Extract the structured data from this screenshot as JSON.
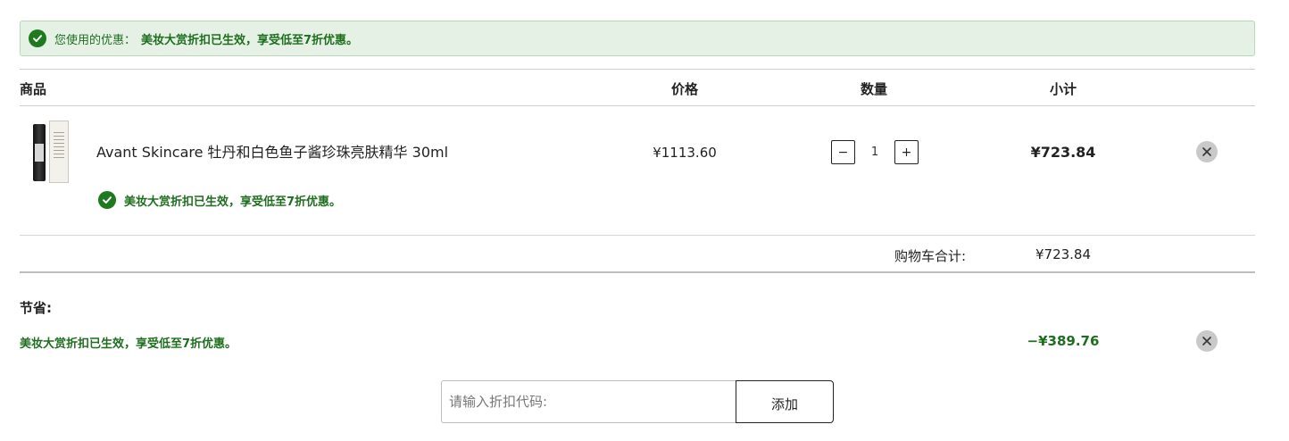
{
  "banner": {
    "label": "您使用的优惠：",
    "message": "美妆大赏折扣已生效，享受低至7折优惠。"
  },
  "table": {
    "headers": {
      "product": "商品",
      "price": "价格",
      "quantity": "数量",
      "subtotal": "小计"
    }
  },
  "item": {
    "name": "Avant Skincare 牡丹和白色鱼子酱珍珠亮肤精华 30ml",
    "promo": "美妆大赏折扣已生效，享受低至7折优惠。",
    "price": "¥1113.60",
    "quantity": "1",
    "minus_label": "−",
    "plus_label": "+",
    "subtotal": "¥723.84"
  },
  "cart_total": {
    "label": "购物车合计:",
    "value": "¥723.84"
  },
  "savings": {
    "title": "节省:",
    "message": "美妆大赏折扣已生效，享受低至7折优惠。",
    "value": "−¥389.76"
  },
  "coupon": {
    "placeholder": "请输入折扣代码:",
    "button_label": "添加"
  },
  "colors": {
    "success_green": "#1f7a1f",
    "banner_bg": "#e6f1e6"
  }
}
